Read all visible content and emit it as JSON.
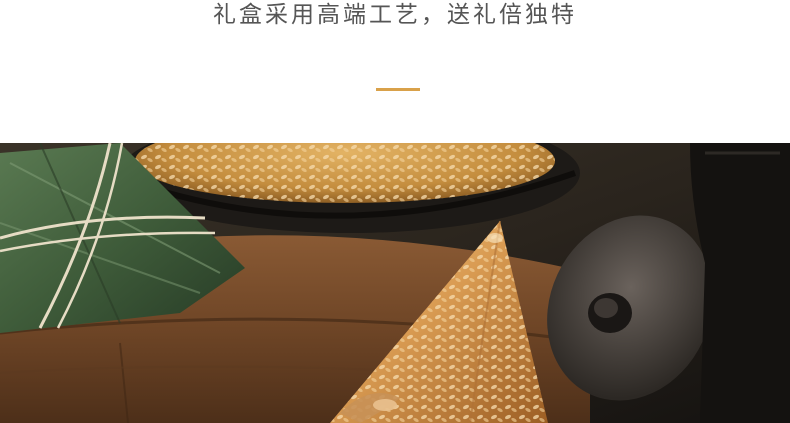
{
  "header": {
    "title": "礼盒采用高端工艺，送礼倍独特"
  },
  "theme": {
    "accent_color": "#d9a14a",
    "text_color": "#555555",
    "background": "#ffffff"
  },
  "photo": {
    "subject": "zongzi-rice-dumpling"
  }
}
